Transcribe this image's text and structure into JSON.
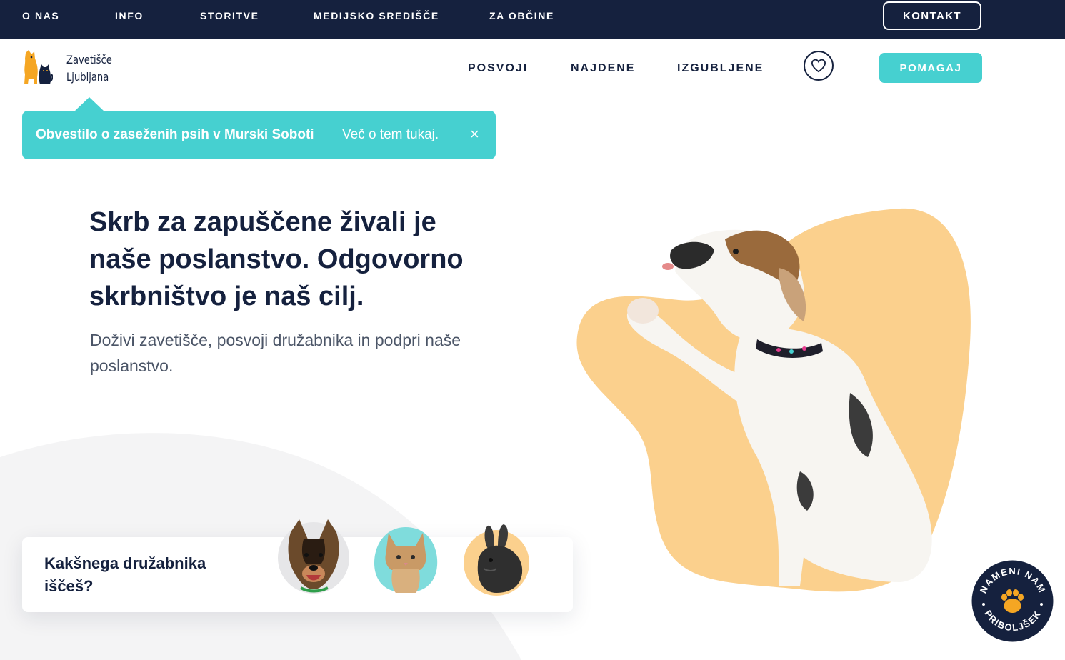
{
  "topbar": {
    "items": [
      "O NAS",
      "INFO",
      "STORITVE",
      "MEDIJSKO SREDIŠČE",
      "ZA OBČINE"
    ],
    "contact_label": "KONTAKT"
  },
  "header": {
    "logo_line1": "Zavetišče",
    "logo_line2": "Ljubljana",
    "nav": [
      "POSVOJI",
      "NAJDENE",
      "IZGUBLJENE"
    ],
    "help_label": "POMAGAJ"
  },
  "notice": {
    "title": "Obvestilo o zaseženih psih v Murski Soboti",
    "link": "Več o tem tukaj.",
    "close": "×"
  },
  "hero": {
    "title": "Skrb za zapuščene živali je naše poslanstvo. Odgovorno skrbništvo je naš cilj.",
    "subtitle": "Doživi zavetišče, posvoji družabnika in podpri naše poslanstvo."
  },
  "finder": {
    "title": "Kakšnega družabnika iščeš?",
    "pets": [
      "dog",
      "cat",
      "rabbit"
    ]
  },
  "badge": {
    "text": "NAMENI NAM PRIBOLJŠEK"
  },
  "colors": {
    "navy": "#15213e",
    "teal": "#46d0d0",
    "peach": "#fbd08d"
  }
}
